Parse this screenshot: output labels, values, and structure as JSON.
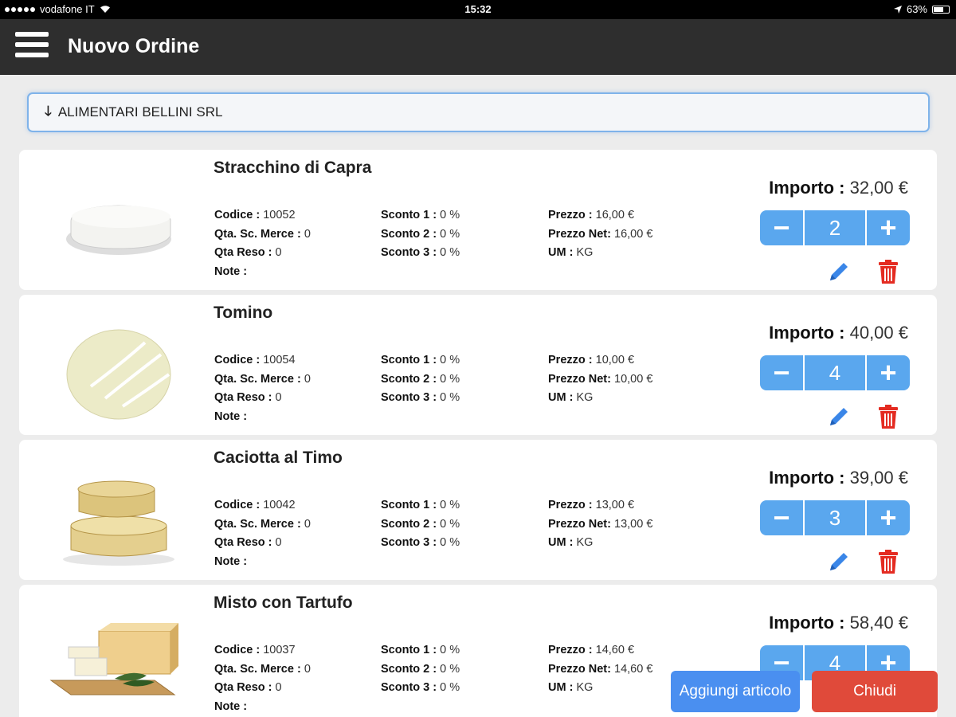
{
  "status_bar": {
    "carrier": "vodafone IT",
    "time": "15:32",
    "battery": "63%"
  },
  "header": {
    "title": "Nuovo Ordine",
    "menu_icon": "hamburger-menu-icon"
  },
  "customer": {
    "name": "ALIMENTARI BELLINI SRL",
    "icon": "arrow-down-icon"
  },
  "labels": {
    "codice": "Codice :",
    "qta_sc_merce": "Qta. Sc. Merce :",
    "qta_reso": "Qta Reso :",
    "note": "Note :",
    "sconto1": "Sconto 1 :",
    "sconto2": "Sconto 2 :",
    "sconto3": "Sconto 3 :",
    "prezzo": "Prezzo :",
    "prezzo_net": "Prezzo Net:",
    "um": "UM :",
    "importo": "Importo :"
  },
  "products": [
    {
      "name": "Stracchino di Capra",
      "codice": "10052",
      "qta_sc_merce": "0",
      "qta_reso": "0",
      "note": "",
      "sconto1": "0 %",
      "sconto2": "0 %",
      "sconto3": "0 %",
      "prezzo": "16,00 €",
      "prezzo_net": "16,00 €",
      "um": "KG",
      "importo": "32,00 €",
      "qty": "2"
    },
    {
      "name": "Tomino",
      "codice": "10054",
      "qta_sc_merce": "0",
      "qta_reso": "0",
      "note": "",
      "sconto1": "0 %",
      "sconto2": "0 %",
      "sconto3": "0 %",
      "prezzo": "10,00 €",
      "prezzo_net": "10,00 €",
      "um": "KG",
      "importo": "40,00 €",
      "qty": "4"
    },
    {
      "name": "Caciotta al Timo",
      "codice": "10042",
      "qta_sc_merce": "0",
      "qta_reso": "0",
      "note": "",
      "sconto1": "0 %",
      "sconto2": "0 %",
      "sconto3": "0 %",
      "prezzo": "13,00 €",
      "prezzo_net": "13,00 €",
      "um": "KG",
      "importo": "39,00 €",
      "qty": "3"
    },
    {
      "name": "Misto con Tartufo",
      "codice": "10037",
      "qta_sc_merce": "0",
      "qta_reso": "0",
      "note": "",
      "sconto1": "0 %",
      "sconto2": "0 %",
      "sconto3": "0 %",
      "prezzo": "14,60 €",
      "prezzo_net": "14,60 €",
      "um": "KG",
      "importo": "58,40 €",
      "qty": "4"
    }
  ],
  "stepper": {
    "minus": "−",
    "plus": "+"
  },
  "footer": {
    "add_label": "Aggiungi articolo",
    "close_label": "Chiudi"
  },
  "colors": {
    "accent_blue": "#5aa7ee",
    "button_blue": "#4a8ff0",
    "danger_red": "#e04a3a",
    "header_dark": "#2e2e2e"
  }
}
